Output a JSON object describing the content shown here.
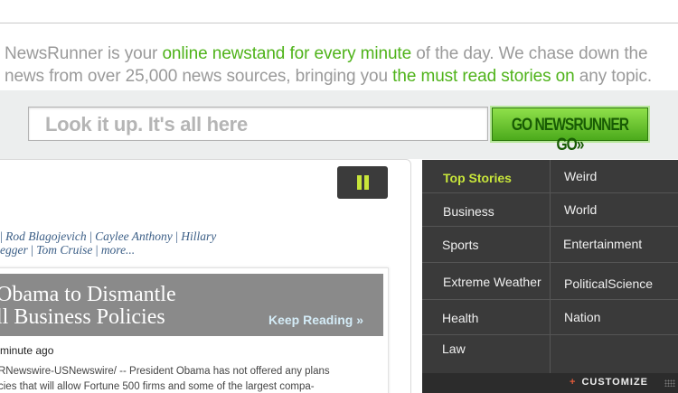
{
  "intro": {
    "p1": "NewsRunner is your ",
    "h1": "online newstand for every minute",
    "p2": " of the day.  We chase down the",
    "p3": "news from over 25,000 news sources, bringing you ",
    "h2": "the must read stories on",
    "p4": " any topic."
  },
  "search": {
    "placeholder": "Look it up. It's all here",
    "button": "GO NEWSRUNNER GO»"
  },
  "tags": {
    "items1": [
      "Rod Blagojevich",
      "Caylee Anthony",
      "Hillary"
    ],
    "items2": [
      "egger",
      "Tom Cruise",
      "more..."
    ]
  },
  "story": {
    "title_line1": "Obama to Dismantle",
    "title_line2": "ll Business Policies",
    "keep_reading": "Keep Reading »",
    "time": "minute ago",
    "snippet_line1": "RNewswire-USNewswire/ -- President Obama has not offered any plans",
    "snippet_line2": "cies that will allow Fortune 500 firms and some of the largest compa-"
  },
  "nav": {
    "left": [
      "Top Stories",
      "Business",
      "Sports",
      "Extreme Weather",
      "Health",
      "Law"
    ],
    "right": [
      "Weird",
      "World",
      "Entertainment",
      "PoliticalScience",
      "Nation"
    ],
    "customize": "CUSTOMIZE",
    "customize_plus": "+"
  },
  "colors": {
    "accent": "#4fb31a",
    "active": "#c8e63a",
    "nav_bg": "#3a3a3a"
  }
}
